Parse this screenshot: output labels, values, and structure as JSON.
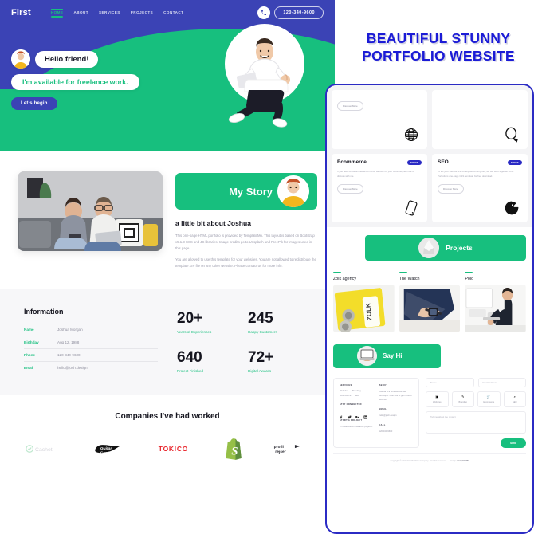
{
  "left_preview": {
    "navbar": {
      "brand": "First",
      "links": [
        {
          "label": "HOME",
          "active": true
        },
        {
          "label": "ABOUT",
          "active": false
        },
        {
          "label": "SERVICES",
          "active": false
        },
        {
          "label": "PROJECTS",
          "active": false
        },
        {
          "label": "CONTACT",
          "active": false
        }
      ],
      "phone_icon": "phone-icon",
      "phone_number": "120-340-9600"
    },
    "hero": {
      "greeting_bubble": "Hello friend!",
      "availability_bubble": "I'm available for freelance work.",
      "cta_label": "Let's begin",
      "avatar_alt": "avatar",
      "photo_alt": "man sitting with laptop"
    },
    "story": {
      "image_alt": "couple on couch with laptop",
      "banner_title": "My Story",
      "banner_avatar_alt": "joshua portrait",
      "heading": "a little bit about Joshua",
      "paragraphs": [
        "This one-page HTML portfolio is provided by TemplateMo. This layout is based on Bootstrap v5.1.3 CSS and JS libraries. Image credits go to Unsplash and FreePik for images used in this page.",
        "You are allowed to use this template for your websites. You are not allowed to redistribute the template ZIP file on any other website. Please contact us for more info."
      ]
    },
    "information": {
      "title": "Information",
      "rows": [
        {
          "key": "Name",
          "value": "Joshua Morgan"
        },
        {
          "key": "Birthday",
          "value": "Aug 12, 1988"
        },
        {
          "key": "Phone",
          "value": "120-340-9600"
        },
        {
          "key": "Email",
          "value": "hello@josh.design"
        }
      ]
    },
    "stats": [
      {
        "number": "20+",
        "label": "Years of Experiences"
      },
      {
        "number": "245",
        "label": "Happy Customers"
      },
      {
        "number": "640",
        "label": "Project Finished"
      },
      {
        "number": "72+",
        "label": "Digital Awards"
      }
    ],
    "companies": {
      "title": "Companies I've had worked",
      "logos": [
        "Cachet",
        "Guitar Center",
        "TOKICO",
        "Shopify",
        "profil rejser"
      ]
    }
  },
  "right_panel": {
    "headline_line1": "BEAUTIFUL STUNNY",
    "headline_line2": "PORTFOLIO WEBSITE",
    "headline_color": "#1b1bd6",
    "accent_green": "#17bf7e",
    "accent_blue": "#2b2bc4",
    "services": {
      "discover_label": "Discover More",
      "badge_label": "MORE",
      "cards": [
        {
          "title": "",
          "icon": "globe-grid-icon",
          "body": "",
          "has_button": true
        },
        {
          "title": "",
          "icon": "balloon-icon",
          "body": "",
          "has_button": false
        },
        {
          "title": "Ecommerce",
          "icon": "mobile-icon",
          "body": "If you need a customized ecommerce website for your business, feel free to discuss with me.",
          "has_button": true
        },
        {
          "title": "SEO",
          "icon": "google-g-icon",
          "body": "To list your website first on any search engines, we will work together. First Portfolio is one-page CSS template for free download.",
          "has_button": true
        }
      ]
    },
    "projects": {
      "banner_title": "Projects",
      "banner_avatar_alt": "projects avatar",
      "items": [
        {
          "name": "Zolk agency",
          "thumb_alt": "yellow zolk cans"
        },
        {
          "name": "The Watch",
          "thumb_alt": "navy watch flatlay"
        },
        {
          "name": "Polo",
          "thumb_alt": "designer at desk"
        }
      ]
    },
    "contact": {
      "banner_title": "Say Hi",
      "banner_avatar_alt": "laptop hands",
      "left_col": {
        "services_heading": "SERVICES",
        "services_chips": [
          "Websites",
          "Branding",
          "Ecommerce",
          "SEO"
        ],
        "stay_connected_heading": "STAY CONNECTED",
        "social_icons": [
          "facebook-icon",
          "twitter-icon",
          "behance-icon",
          "linkedin-icon"
        ],
        "start_project_heading": "START A PROJECT",
        "start_project_text": "I'm available for freelance projects."
      },
      "right_col": {
        "about_heading": "ABOUT",
        "about_text": "Joshua is a professional web developer. Feel free to get in touch with me.",
        "email_heading": "EMAIL",
        "email_value": "hello@josh.design",
        "call_heading": "CALL",
        "call_value": "120-340-9600"
      },
      "form": {
        "name_placeholder": "Name",
        "email_placeholder": "Email address",
        "options": [
          {
            "label": "Websites",
            "icon": "monitor-icon"
          },
          {
            "label": "Branding",
            "icon": "brush-icon"
          },
          {
            "label": "Ecommerce",
            "icon": "cart-icon"
          },
          {
            "label": "SEO",
            "icon": "search-icon"
          }
        ],
        "message_placeholder": "Tell me about the project",
        "send_label": "Send"
      }
    },
    "footer": {
      "copyright": "Copyright © 2021 First Portfolio Company. All rights reserved.",
      "design_credit_label": "Design:",
      "design_credit_name": "TemplateMo"
    }
  }
}
